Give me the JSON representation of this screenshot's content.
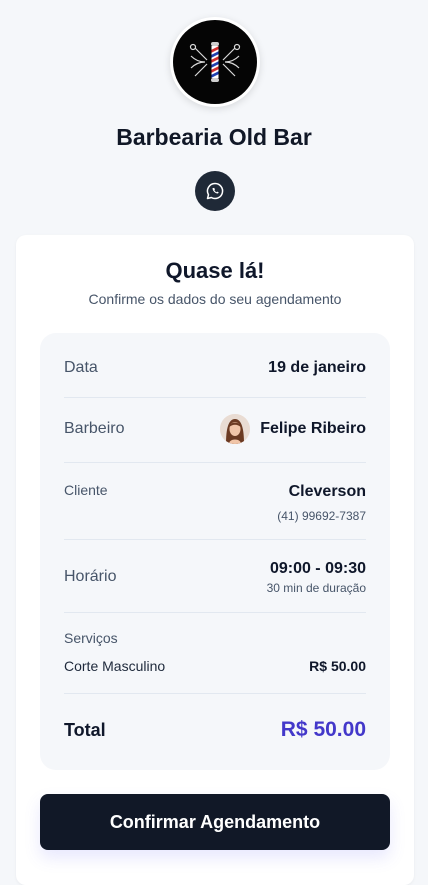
{
  "shop": {
    "name": "Barbearia Old Bar",
    "logo_icon": "barber-pole-logo",
    "contact_icon": "whatsapp-icon"
  },
  "confirmation": {
    "title": "Quase lá!",
    "subtitle": "Confirme os dados do seu agendamento"
  },
  "summary": {
    "date": {
      "label": "Data",
      "value": "19 de janeiro"
    },
    "barber": {
      "label": "Barbeiro",
      "name": "Felipe Ribeiro"
    },
    "client": {
      "label": "Cliente",
      "name": "Cleverson",
      "phone": "(41) 99692-7387"
    },
    "time": {
      "label": "Horário",
      "value": "09:00 - 09:30",
      "duration": "30 min de duração"
    },
    "services": {
      "label": "Serviços",
      "items": [
        {
          "name": "Corte Masculino",
          "price": "R$ 50.00"
        }
      ]
    },
    "total": {
      "label": "Total",
      "value": "R$ 50.00"
    }
  },
  "actions": {
    "confirm_label": "Confirmar Agendamento"
  },
  "colors": {
    "accent": "#4338ca",
    "dark": "#111827",
    "background": "#f5f7fa"
  }
}
